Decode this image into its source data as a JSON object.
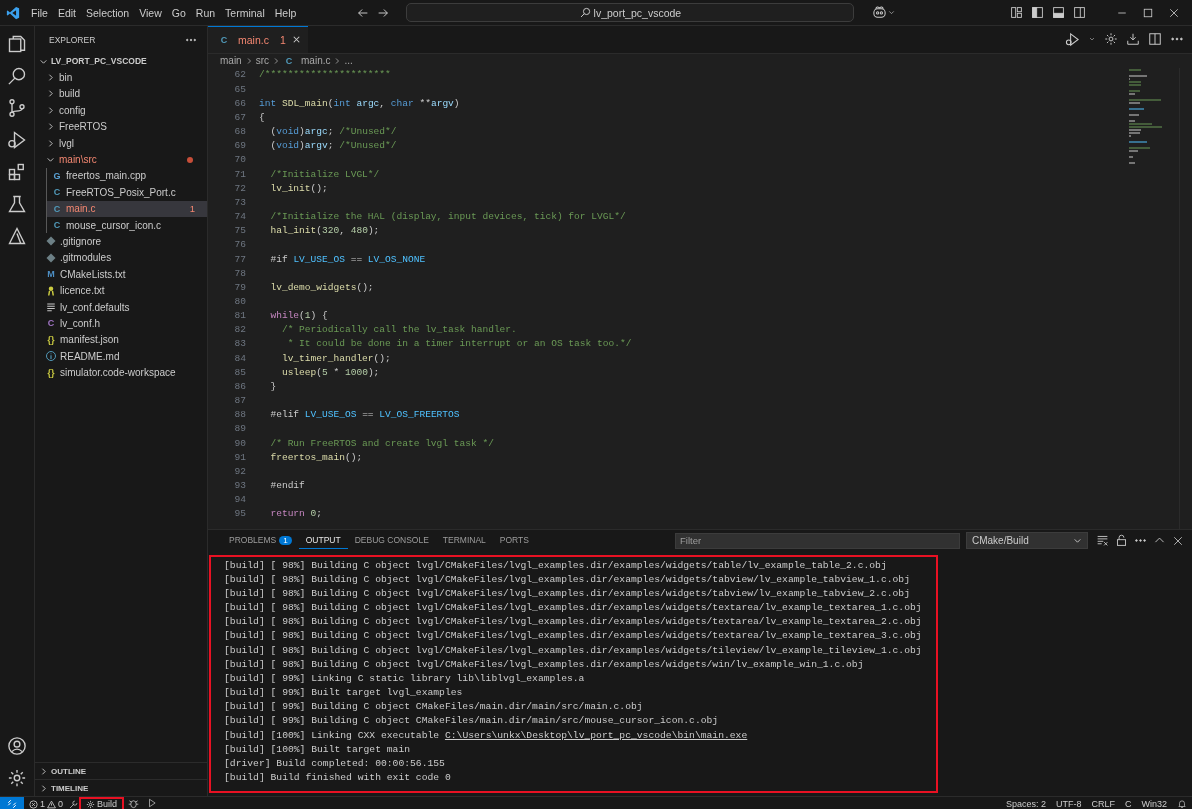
{
  "title_bar": {
    "menu": [
      "File",
      "Edit",
      "Selection",
      "View",
      "Go",
      "Run",
      "Terminal",
      "Help"
    ],
    "command_center": "lv_port_pc_vscode"
  },
  "explorer": {
    "title": "EXPLORER",
    "root": "LV_PORT_PC_VSCODE",
    "root_expanded": true,
    "items": [
      {
        "kind": "folder",
        "name": "bin",
        "expanded": false,
        "modified": false,
        "selected": false
      },
      {
        "kind": "folder",
        "name": "build",
        "expanded": false,
        "modified": false,
        "selected": false
      },
      {
        "kind": "folder",
        "name": "config",
        "expanded": false,
        "modified": false,
        "selected": false
      },
      {
        "kind": "folder",
        "name": "FreeRTOS",
        "expanded": false,
        "modified": false,
        "selected": false
      },
      {
        "kind": "folder",
        "name": "lvgl",
        "expanded": false,
        "modified": false,
        "selected": false
      },
      {
        "kind": "folder",
        "name": "main\\src",
        "expanded": true,
        "modified": true,
        "selected": false,
        "children": [
          {
            "kind": "cpp",
            "glyph": "G",
            "name": "freertos_main.cpp",
            "selected": false,
            "error": false
          },
          {
            "kind": "c",
            "glyph": "C",
            "name": "FreeRTOS_Posix_Port.c",
            "selected": false,
            "error": false
          },
          {
            "kind": "c",
            "glyph": "C",
            "name": "main.c",
            "selected": true,
            "error": true,
            "badge": "1"
          },
          {
            "kind": "c",
            "glyph": "C",
            "name": "mouse_cursor_icon.c",
            "selected": false,
            "error": false
          }
        ]
      },
      {
        "kind": "git",
        "name": ".gitignore",
        "selected": false,
        "error": false
      },
      {
        "kind": "git",
        "name": ".gitmodules",
        "selected": false,
        "error": false
      },
      {
        "kind": "cmake",
        "glyph": "M",
        "name": "CMakeLists.txt",
        "selected": false,
        "error": false
      },
      {
        "kind": "license",
        "name": "licence.txt",
        "selected": false,
        "error": false
      },
      {
        "kind": "text",
        "name": "lv_conf.defaults",
        "selected": false,
        "error": false
      },
      {
        "kind": "header",
        "glyph": "C",
        "name": "lv_conf.h",
        "selected": false,
        "error": false
      },
      {
        "kind": "json",
        "glyph": "{}",
        "name": "manifest.json",
        "selected": false,
        "error": false
      },
      {
        "kind": "info",
        "name": "README.md",
        "selected": false,
        "error": false
      },
      {
        "kind": "json",
        "glyph": "{}",
        "name": "simulator.code-workspace",
        "selected": false,
        "error": false
      }
    ],
    "sections": [
      {
        "label": "OUTLINE",
        "expanded": false
      },
      {
        "label": "TIMELINE",
        "expanded": false
      }
    ]
  },
  "editor": {
    "tabs": [
      {
        "glyph": "C",
        "label": "main.c",
        "badge": "1",
        "error": true,
        "selected": true
      }
    ],
    "breadcrumb": [
      "main",
      "src",
      "main.c",
      "..."
    ],
    "breadcrumb_glyph": "C",
    "lines": [
      {
        "n": "62",
        "tokens": [
          {
            "kind": "cm",
            "text": "/**********************"
          }
        ]
      },
      {
        "n": "65"
      },
      {
        "n": "66",
        "tokens": [
          {
            "kind": "kw",
            "text": "int "
          },
          {
            "kind": "fn",
            "text": "SDL_main"
          },
          {
            "kind": "p",
            "text": "("
          },
          {
            "kind": "kw",
            "text": "int "
          },
          {
            "kind": "var",
            "text": "argc"
          },
          {
            "kind": "p",
            "text": ", "
          },
          {
            "kind": "kw",
            "text": "char "
          },
          {
            "kind": "p",
            "text": "**"
          },
          {
            "kind": "var",
            "text": "argv"
          },
          {
            "kind": "p",
            "text": ")"
          }
        ]
      },
      {
        "n": "67",
        "tokens": [
          {
            "kind": "p",
            "text": "{"
          }
        ]
      },
      {
        "n": "68",
        "tokens": [
          {
            "kind": "p",
            "text": "  ("
          },
          {
            "kind": "kw",
            "text": "void"
          },
          {
            "kind": "p",
            "text": ")"
          },
          {
            "kind": "var",
            "text": "argc"
          },
          {
            "kind": "p",
            "text": "; "
          },
          {
            "kind": "cm",
            "text": "/*Unused*/"
          }
        ]
      },
      {
        "n": "69",
        "tokens": [
          {
            "kind": "p",
            "text": "  ("
          },
          {
            "kind": "kw",
            "text": "void"
          },
          {
            "kind": "p",
            "text": ")"
          },
          {
            "kind": "var",
            "text": "argv"
          },
          {
            "kind": "p",
            "text": "; "
          },
          {
            "kind": "cm",
            "text": "/*Unused*/"
          }
        ]
      },
      {
        "n": "70"
      },
      {
        "n": "71",
        "tokens": [
          {
            "kind": "cm",
            "text": "  /*Initialize LVGL*/"
          }
        ]
      },
      {
        "n": "72",
        "tokens": [
          {
            "kind": "fn",
            "text": "  lv_init"
          },
          {
            "kind": "p",
            "text": "();"
          }
        ]
      },
      {
        "n": "73"
      },
      {
        "n": "74",
        "tokens": [
          {
            "kind": "cm",
            "text": "  /*Initialize the HAL (display, input devices, tick) for LVGL*/"
          }
        ]
      },
      {
        "n": "75",
        "tokens": [
          {
            "kind": "fn",
            "text": "  hal_init"
          },
          {
            "kind": "p",
            "text": "("
          },
          {
            "kind": "num",
            "text": "320"
          },
          {
            "kind": "p",
            "text": ", "
          },
          {
            "kind": "num",
            "text": "480"
          },
          {
            "kind": "p",
            "text": ");"
          }
        ]
      },
      {
        "n": "76"
      },
      {
        "n": "77",
        "tokens": [
          {
            "kind": "p",
            "text": "  #if "
          },
          {
            "kind": "mac",
            "text": "LV_USE_OS"
          },
          {
            "kind": "p",
            "text": " == "
          },
          {
            "kind": "mac",
            "text": "LV_OS_NONE"
          }
        ]
      },
      {
        "n": "78"
      },
      {
        "n": "79",
        "tokens": [
          {
            "kind": "fn",
            "text": "  lv_demo_widgets"
          },
          {
            "kind": "p",
            "text": "();"
          }
        ]
      },
      {
        "n": "80"
      },
      {
        "n": "81",
        "tokens": [
          {
            "kind": "ctl",
            "text": "  while"
          },
          {
            "kind": "p",
            "text": "("
          },
          {
            "kind": "num",
            "text": "1"
          },
          {
            "kind": "p",
            "text": ") {"
          }
        ]
      },
      {
        "n": "82",
        "tokens": [
          {
            "kind": "cm",
            "text": "    /* Periodically call the lv_task handler."
          }
        ]
      },
      {
        "n": "83",
        "tokens": [
          {
            "kind": "cm",
            "text": "     * It could be done in a timer interrupt or an OS task too.*/"
          }
        ]
      },
      {
        "n": "84",
        "tokens": [
          {
            "kind": "fn",
            "text": "    lv_timer_handler"
          },
          {
            "kind": "p",
            "text": "();"
          }
        ]
      },
      {
        "n": "85",
        "tokens": [
          {
            "kind": "fn",
            "text": "    usleep"
          },
          {
            "kind": "p",
            "text": "("
          },
          {
            "kind": "num",
            "text": "5"
          },
          {
            "kind": "p",
            "text": " * "
          },
          {
            "kind": "num",
            "text": "1000"
          },
          {
            "kind": "p",
            "text": ");"
          }
        ]
      },
      {
        "n": "86",
        "tokens": [
          {
            "kind": "p",
            "text": "  }"
          }
        ]
      },
      {
        "n": "87"
      },
      {
        "n": "88",
        "tokens": [
          {
            "kind": "p",
            "text": "  #elif "
          },
          {
            "kind": "mac",
            "text": "LV_USE_OS"
          },
          {
            "kind": "p",
            "text": " == "
          },
          {
            "kind": "mac",
            "text": "LV_OS_FREERTOS"
          }
        ]
      },
      {
        "n": "89"
      },
      {
        "n": "90",
        "tokens": [
          {
            "kind": "cm",
            "text": "  /* Run FreeRTOS and create lvgl task */"
          }
        ]
      },
      {
        "n": "91",
        "tokens": [
          {
            "kind": "fn",
            "text": "  freertos_main"
          },
          {
            "kind": "p",
            "text": "();"
          }
        ]
      },
      {
        "n": "92"
      },
      {
        "n": "93",
        "tokens": [
          {
            "kind": "p",
            "text": "  #endif"
          }
        ]
      },
      {
        "n": "94"
      },
      {
        "n": "95",
        "tokens": [
          {
            "kind": "ctl",
            "text": "  return "
          },
          {
            "kind": "num",
            "text": "0"
          },
          {
            "kind": "p",
            "text": ";"
          }
        ]
      }
    ]
  },
  "panel": {
    "tabs": [
      {
        "label": "PROBLEMS",
        "badge": "1",
        "selected": false
      },
      {
        "label": "OUTPUT",
        "selected": true
      },
      {
        "label": "DEBUG CONSOLE",
        "selected": false
      },
      {
        "label": "TERMINAL",
        "selected": false
      },
      {
        "label": "PORTS",
        "selected": false
      }
    ],
    "filter": {
      "placeholder": "Filter"
    },
    "channel": "CMake/Build",
    "highlighted": true,
    "output": [
      {
        "text": "[build] [ 98%] Building C object lvgl/CMakeFiles/lvgl_examples.dir/examples/widgets/table/lv_example_table_2.c.obj"
      },
      {
        "text": "[build] [ 98%] Building C object lvgl/CMakeFiles/lvgl_examples.dir/examples/widgets/tabview/lv_example_tabview_1.c.obj"
      },
      {
        "text": "[build] [ 98%] Building C object lvgl/CMakeFiles/lvgl_examples.dir/examples/widgets/tabview/lv_example_tabview_2.c.obj"
      },
      {
        "text": "[build] [ 98%] Building C object lvgl/CMakeFiles/lvgl_examples.dir/examples/widgets/textarea/lv_example_textarea_1.c.obj"
      },
      {
        "text": "[build] [ 98%] Building C object lvgl/CMakeFiles/lvgl_examples.dir/examples/widgets/textarea/lv_example_textarea_2.c.obj"
      },
      {
        "text": "[build] [ 98%] Building C object lvgl/CMakeFiles/lvgl_examples.dir/examples/widgets/textarea/lv_example_textarea_3.c.obj"
      },
      {
        "text": "[build] [ 98%] Building C object lvgl/CMakeFiles/lvgl_examples.dir/examples/widgets/tileview/lv_example_tileview_1.c.obj"
      },
      {
        "text": "[build] [ 98%] Building C object lvgl/CMakeFiles/lvgl_examples.dir/examples/widgets/win/lv_example_win_1.c.obj"
      },
      {
        "text": "[build] [ 99%] Linking C static library lib\\liblvgl_examples.a"
      },
      {
        "text": "[build] [ 99%] Built target lvgl_examples"
      },
      {
        "text": "[build] [ 99%] Building C object CMakeFiles/main.dir/main/src/main.c.obj"
      },
      {
        "text": "[build] [ 99%] Building C object CMakeFiles/main.dir/main/src/mouse_cursor_icon.c.obj"
      },
      {
        "text": "[build] [100%] Linking CXX executable",
        "link": "C:\\Users\\unkx\\Desktop\\lv_port_pc_vscode\\bin\\main.exe"
      },
      {
        "text": "[build] [100%] Built target main"
      },
      {
        "text": "[driver] Build completed: 00:00:56.155"
      },
      {
        "text": "[build] Build finished with exit code 0"
      }
    ]
  },
  "status_bar": {
    "errors": "1",
    "warnings": "0",
    "build": "Build",
    "build_highlighted": true,
    "right": [
      "Spaces: 2",
      "UTF-8",
      "CRLF",
      "C",
      "Win32"
    ]
  }
}
